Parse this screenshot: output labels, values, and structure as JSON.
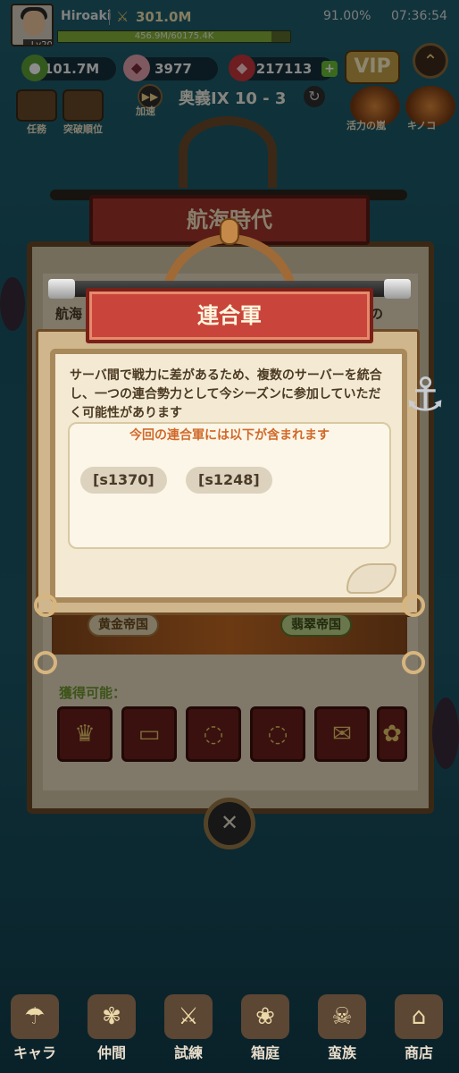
{
  "player": {
    "name": "Hiroaki",
    "level": "Lv200",
    "power": "301.0M",
    "exp_text": "456.9M/60175.4K",
    "exp_fraction": 0.92
  },
  "status": {
    "battery": "91.00%",
    "time": "07:36:54"
  },
  "currencies": [
    {
      "name": "coin",
      "value": "101.7M"
    },
    {
      "name": "gem-pink",
      "value": "3977"
    },
    {
      "name": "ruby",
      "value": "217113"
    }
  ],
  "vip_label": "VIP",
  "buttons": {
    "task": "任務",
    "breakthrough": "突破順位",
    "speed": "加速",
    "event1": "活力の嵐",
    "event2": "キノコ"
  },
  "stage": "奥義IX  10 - 3",
  "background": {
    "title": "航海時代",
    "text_left": "航海",
    "text_right": "の"
  },
  "modal": {
    "title": "連合軍",
    "description": "サーバ間で戦力に差があるため、複数のサーバーを統合し、一つの連合勢力として今シーズンに参加していただく可能性があります",
    "inner_title": "今回の連合軍には以下が含まれます",
    "servers": [
      "[s1370]",
      "[s1248]"
    ]
  },
  "factions": {
    "left": "黄金帝国",
    "right": "翡翠帝国"
  },
  "rewards_label": "獲得可能：",
  "nav": [
    "キャラ",
    "仲間",
    "試練",
    "箱庭",
    "蛮族",
    "商店"
  ],
  "colors": {
    "banner_red": "#c9453b",
    "parchment": "#f4ead3",
    "highlight_orange": "#d2692a",
    "reward_green": "#6f9a2e"
  }
}
